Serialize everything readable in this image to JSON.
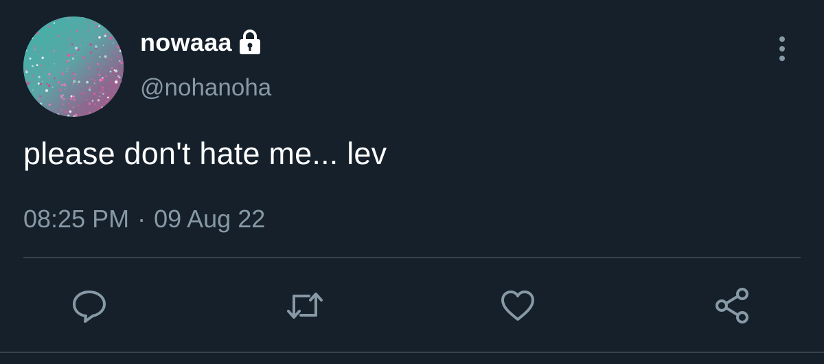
{
  "user": {
    "display_name": "nowaaa",
    "handle": "@nohanoha",
    "avatar_icon": "avatar-glitter-image",
    "protected_icon": "lock-icon"
  },
  "tweet": {
    "text": "please don't hate me... lev",
    "time": "08:25 PM",
    "separator": "·",
    "date": "09 Aug 22"
  },
  "actions": [
    {
      "name": "reply",
      "icon": "comment-icon"
    },
    {
      "name": "retweet",
      "icon": "retweet-icon"
    },
    {
      "name": "like",
      "icon": "heart-icon"
    },
    {
      "name": "share",
      "icon": "share-icon"
    }
  ],
  "colors": {
    "background": "#15202b",
    "text_primary": "#ffffff",
    "text_secondary": "#8899a6",
    "divider": "#38444d"
  }
}
